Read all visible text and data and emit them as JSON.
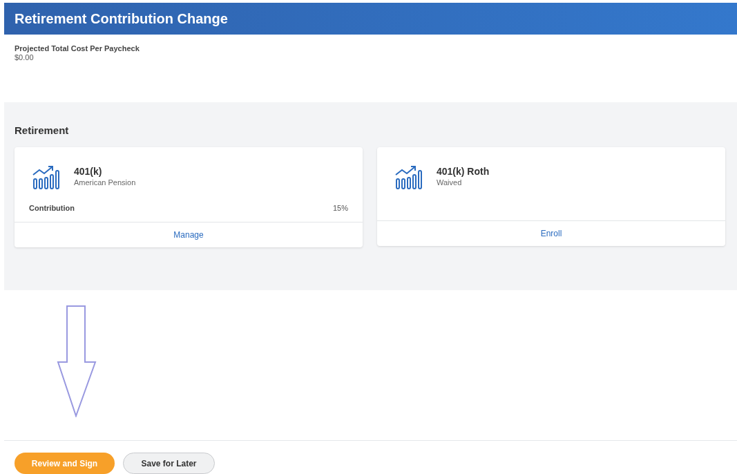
{
  "header": {
    "title": "Retirement Contribution Change"
  },
  "summary": {
    "label": "Projected Total Cost Per Paycheck",
    "value": "$0.00"
  },
  "section": {
    "title": "Retirement",
    "cards": [
      {
        "title": "401(k)",
        "subtitle": "American Pension",
        "details": [
          {
            "label": "Contribution",
            "value": "15%"
          }
        ],
        "action": "Manage"
      },
      {
        "title": "401(k) Roth",
        "subtitle": "Waived",
        "action": "Enroll"
      }
    ]
  },
  "annotation": {
    "kind": "down-arrow"
  },
  "buttons": [
    {
      "label": "Review and Sign",
      "kind": "primary"
    },
    {
      "label": "Save for Later",
      "kind": "secondary"
    }
  ]
}
